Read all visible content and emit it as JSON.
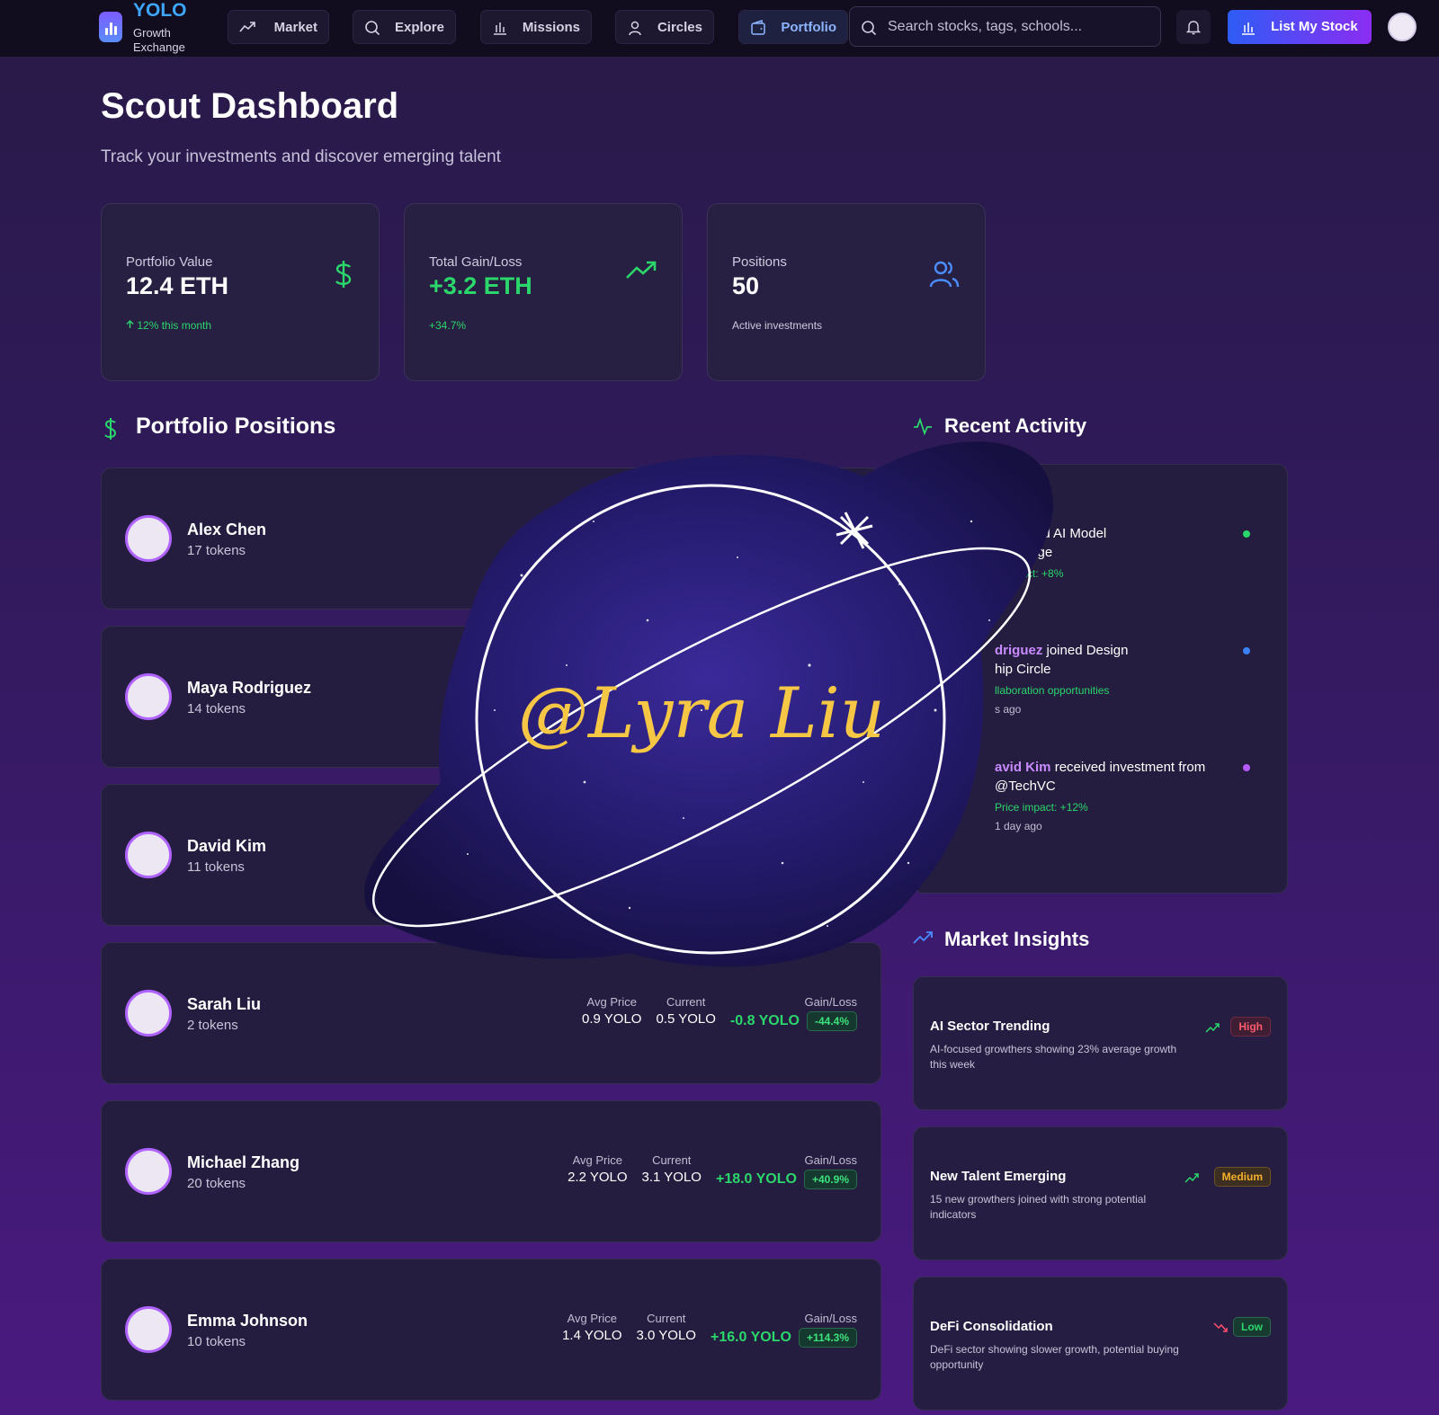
{
  "nav": {
    "logo_title": "YOLO",
    "logo_subtitle": "Growth Exchange",
    "items": [
      {
        "label": "Market",
        "icon": "trending-up-icon"
      },
      {
        "label": "Explore",
        "icon": "search-icon"
      },
      {
        "label": "Missions",
        "icon": "bar-chart-icon"
      },
      {
        "label": "Circles",
        "icon": "user-icon"
      },
      {
        "label": "Portfolio",
        "icon": "wallet-icon",
        "active": true
      }
    ],
    "search_placeholder": "Search stocks, tags, schools...",
    "list_button": "List My Stock"
  },
  "header": {
    "title": "Scout Dashboard",
    "subtitle": "Track your investments and discover emerging talent"
  },
  "stats": [
    {
      "label": "Portfolio Value",
      "value": "12.4 ETH",
      "footer": "12% this month",
      "icon": "dollar-icon"
    },
    {
      "label": "Total Gain/Loss",
      "value": "+3.2 ETH",
      "footer": "+34.7%",
      "icon": "trending-up-icon"
    },
    {
      "label": "Positions",
      "value": "50",
      "footer": "Active investments",
      "icon": "users-icon"
    }
  ],
  "positions": {
    "title": "Portfolio Positions",
    "col_avg": "Avg Price",
    "col_current": "Current",
    "col_gain": "Gain/Loss",
    "items": [
      {
        "name": "Alex Chen",
        "tokens": "17 tokens"
      },
      {
        "name": "Maya Rodriguez",
        "tokens": "14 tokens"
      },
      {
        "name": "David Kim",
        "tokens": "11 tokens"
      },
      {
        "name": "Sarah Liu",
        "tokens": "2 tokens",
        "avg": "0.9 YOLO",
        "current": "0.5 YOLO",
        "gain": "-0.8 YOLO",
        "pct": "-44.4%"
      },
      {
        "name": "Michael Zhang",
        "tokens": "20 tokens",
        "avg": "2.2 YOLO",
        "current": "3.1 YOLO",
        "gain": "+18.0 YOLO",
        "pct": "+40.9%"
      },
      {
        "name": "Emma Johnson",
        "tokens": "10 tokens",
        "avg": "1.4 YOLO",
        "current": "3.0 YOLO",
        "gain": "+16.0 YOLO",
        "pct": "+114.3%"
      }
    ]
  },
  "activity": {
    "title": "Recent Activity",
    "items": [
      {
        "text_a": "",
        "text_b": "ompleted AI Model",
        "text_c": "challenge",
        "sub": "e impact: +8%",
        "time": "",
        "color": "#2bd66b"
      },
      {
        "text_a": "driguez",
        "text_b": " joined Design",
        "text_c": "hip Circle",
        "sub": "llaboration opportunities",
        "time": "s ago",
        "color": "#3b82f6"
      },
      {
        "text_a": "avid Kim",
        "text_b": " received investment from",
        "text_c": "@TechVC",
        "sub": "Price impact: +12%",
        "time": "1 day ago",
        "color": "#b45cff"
      }
    ]
  },
  "insights": {
    "title": "Market Insights",
    "items": [
      {
        "title": "AI Sector Trending",
        "desc": "AI-focused growthers showing 23% average growth this week",
        "badge": "High",
        "badge_color": "#ff5a6e",
        "trend": "up"
      },
      {
        "title": "New Talent Emerging",
        "desc": "15 new growthers joined with strong potential indicators",
        "badge": "Medium",
        "badge_color": "#f5b12b",
        "trend": "up"
      },
      {
        "title": "DeFi Consolidation",
        "desc": "DeFi sector showing slower growth, potential buying opportunity",
        "badge": "Low",
        "badge_color": "#2bd66b",
        "trend": "down"
      }
    ]
  },
  "watermark": {
    "text": "@Lyra Liu"
  },
  "colors": {
    "green": "#2bd66b",
    "accent_blue": "#3ea6ff",
    "purple": "#b063ff"
  }
}
